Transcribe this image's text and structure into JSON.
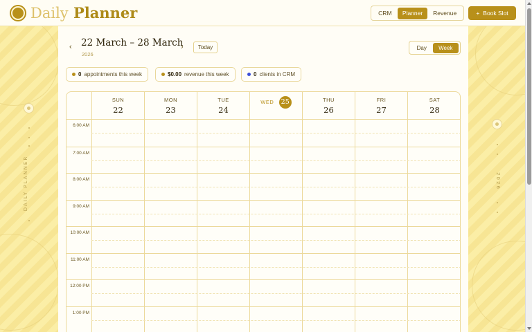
{
  "app": {
    "brand_first": "Daily",
    "brand_second": "Planner"
  },
  "nav": {
    "crm": "CRM",
    "planner": "Planner",
    "revenue": "Revenue",
    "active": "Planner"
  },
  "book_slot": {
    "icon": "plus-icon",
    "label": "Book Slot"
  },
  "sidebar_left": {
    "label": "DAILY PLANNER"
  },
  "sidebar_right": {
    "label": "2026"
  },
  "toolbar": {
    "range_title": "22 March – 28 March",
    "year": "2026",
    "today_label": "Today",
    "prev_icon": "chevron-left-icon",
    "next_icon": "chevron-right-icon",
    "prev_glyph": "‹",
    "next_glyph": "›",
    "view_day": "Day",
    "view_week": "Week",
    "active_view": "Week"
  },
  "stats": [
    {
      "value": "0",
      "label": "appointments this week",
      "color": "#b8901a"
    },
    {
      "value": "$0.00",
      "label": "revenue this week",
      "color": "#b8901a"
    },
    {
      "value": "0",
      "label": "clients in CRM",
      "color": "#3b4fd9"
    }
  ],
  "days": [
    {
      "name": "SUN",
      "num": "22"
    },
    {
      "name": "MON",
      "num": "23"
    },
    {
      "name": "TUE",
      "num": "24"
    },
    {
      "name": "WED",
      "num": "25",
      "today": true
    },
    {
      "name": "THU",
      "num": "26"
    },
    {
      "name": "FRI",
      "num": "27"
    },
    {
      "name": "SAT",
      "num": "28"
    }
  ],
  "hours": [
    "6:00 AM",
    "7:00 AM",
    "8:00 AM",
    "9:00 AM",
    "10:00 AM",
    "11:00 AM",
    "12:00 PM",
    "1:00 PM"
  ],
  "colors": {
    "accent": "#b8901a",
    "background": "#fbf0b4",
    "grid": "#ecd99a"
  }
}
